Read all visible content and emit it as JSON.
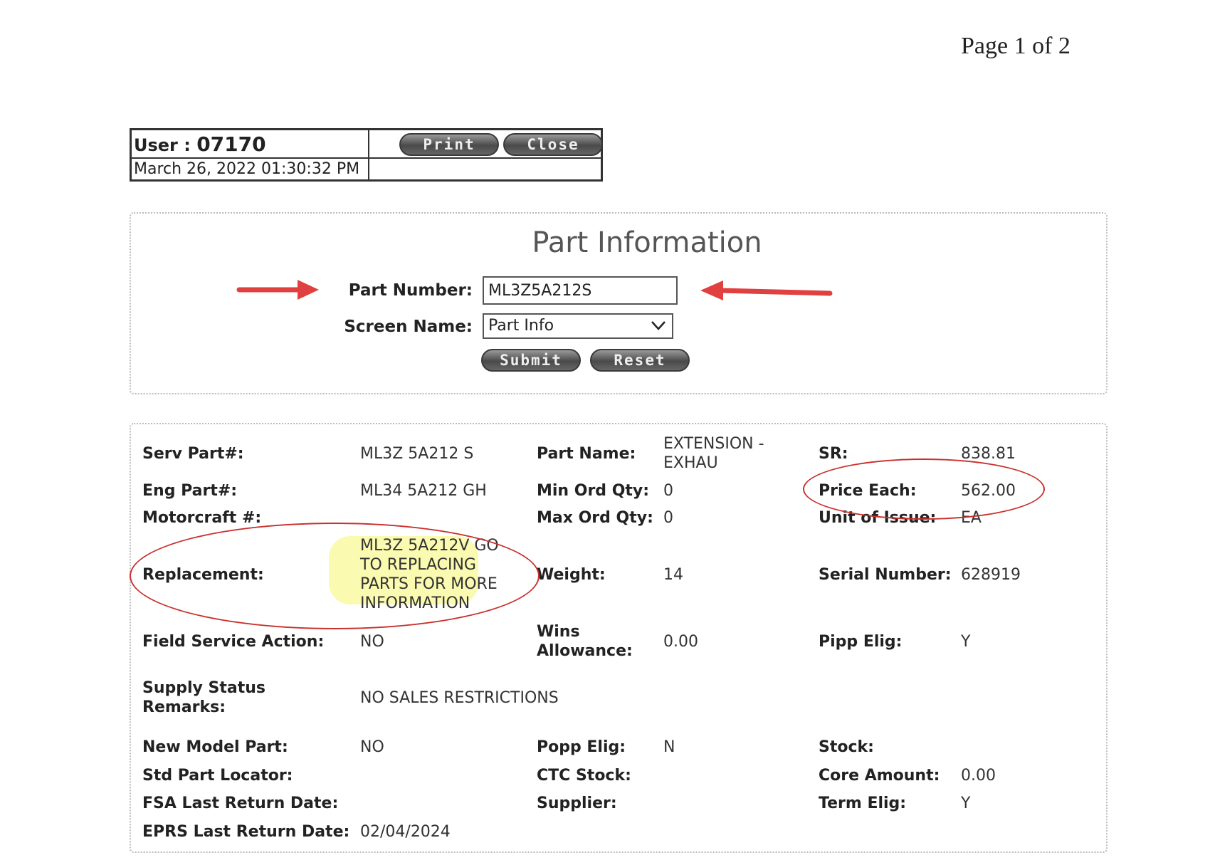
{
  "page_label": "Page 1 of 2",
  "header": {
    "user_label": "User :",
    "user_id": "07170",
    "datetime": "March 26, 2022 01:30:32 PM",
    "print_label": "Print",
    "close_label": "Close"
  },
  "form": {
    "title": "Part Information",
    "part_number_label": "Part Number:",
    "part_number_value": "ML3Z5A212S",
    "screen_name_label": "Screen Name:",
    "screen_name_value": "Part Info",
    "submit_label": "Submit",
    "reset_label": "Reset"
  },
  "details": {
    "serv_part_label": "Serv Part#:",
    "serv_part_value": "ML3Z 5A212 S",
    "part_name_label": "Part Name:",
    "part_name_line1": "EXTENSION -",
    "part_name_line2": "EXHAU",
    "sr_label": "SR:",
    "sr_value": "838.81",
    "eng_part_label": "Eng Part#:",
    "eng_part_value": "ML34 5A212 GH",
    "min_ord_label": "Min Ord Qty:",
    "min_ord_value": "0",
    "price_each_label": "Price Each:",
    "price_each_value": "562.00",
    "motorcraft_label": "Motorcraft #:",
    "max_ord_label": "Max Ord Qty:",
    "max_ord_value": "0",
    "unit_issue_label": "Unit of Issue:",
    "unit_issue_value": "EA",
    "replacement_label": "Replacement:",
    "replacement_line1": "ML3Z 5A212V GO",
    "replacement_line2": "TO REPLACING",
    "replacement_line3": "PARTS FOR MORE",
    "replacement_line4": "INFORMATION",
    "weight_label": "Weight:",
    "weight_value": "14",
    "serial_label": "Serial Number:",
    "serial_value": "628919",
    "fsa_label": "Field Service Action:",
    "fsa_value": "NO",
    "wins_label_line1": "Wins",
    "wins_label_line2": "Allowance:",
    "wins_value": "0.00",
    "pipp_label": "Pipp Elig:",
    "pipp_value": "Y",
    "supply_label_line1": "Supply Status",
    "supply_label_line2": "Remarks:",
    "supply_value": "NO SALES RESTRICTIONS",
    "new_model_label": "New Model Part:",
    "new_model_value": "NO",
    "popp_label": "Popp Elig:",
    "popp_value": "N",
    "stock_label": "Stock:",
    "std_locator_label": "Std Part Locator:",
    "ctc_label": "CTC Stock:",
    "core_label": "Core Amount:",
    "core_value": "0.00",
    "fsa_last_label": "FSA Last Return Date:",
    "supplier_label": "Supplier:",
    "term_label": "Term Elig:",
    "term_value": "Y",
    "eprs_label": "EPRS Last Return Date:",
    "eprs_value": "02/04/2024"
  },
  "annotation_color": "#c9302c",
  "highlight_color": "#f5f550"
}
